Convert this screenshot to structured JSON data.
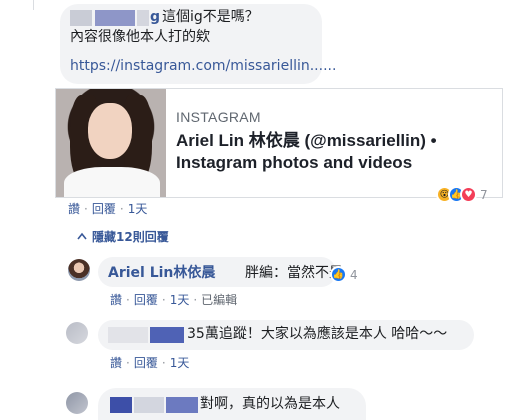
{
  "top_comment": {
    "author_visible_fragment": "g",
    "line1_text": "這個ig不是嗎？",
    "line2_text": "內容很像他本人打的欸",
    "link_text": "https://instagram.com/missariellin......",
    "link_card": {
      "source": "INSTAGRAM",
      "title": "Ariel Lin 林依晨 (@missariellin) • Instagram photos and videos"
    },
    "actions": {
      "like": "讚",
      "reply": "回覆",
      "time": "1天"
    },
    "reaction_count": "7"
  },
  "replies_toggle": "隱藏12則回覆",
  "reply": {
    "author": "Ariel Lin林依晨",
    "text": "胖編：當然不是",
    "reaction_count": "4",
    "actions": {
      "like": "讚",
      "reply": "回覆",
      "time": "1天",
      "edited": "已編輯"
    }
  },
  "comment3": {
    "text": "35萬追蹤！大家以為應該是本人 哈哈～～",
    "actions": {
      "like": "讚",
      "reply": "回覆",
      "time": "1天"
    }
  },
  "comment4": {
    "text": "對啊，真的以為是本人"
  }
}
